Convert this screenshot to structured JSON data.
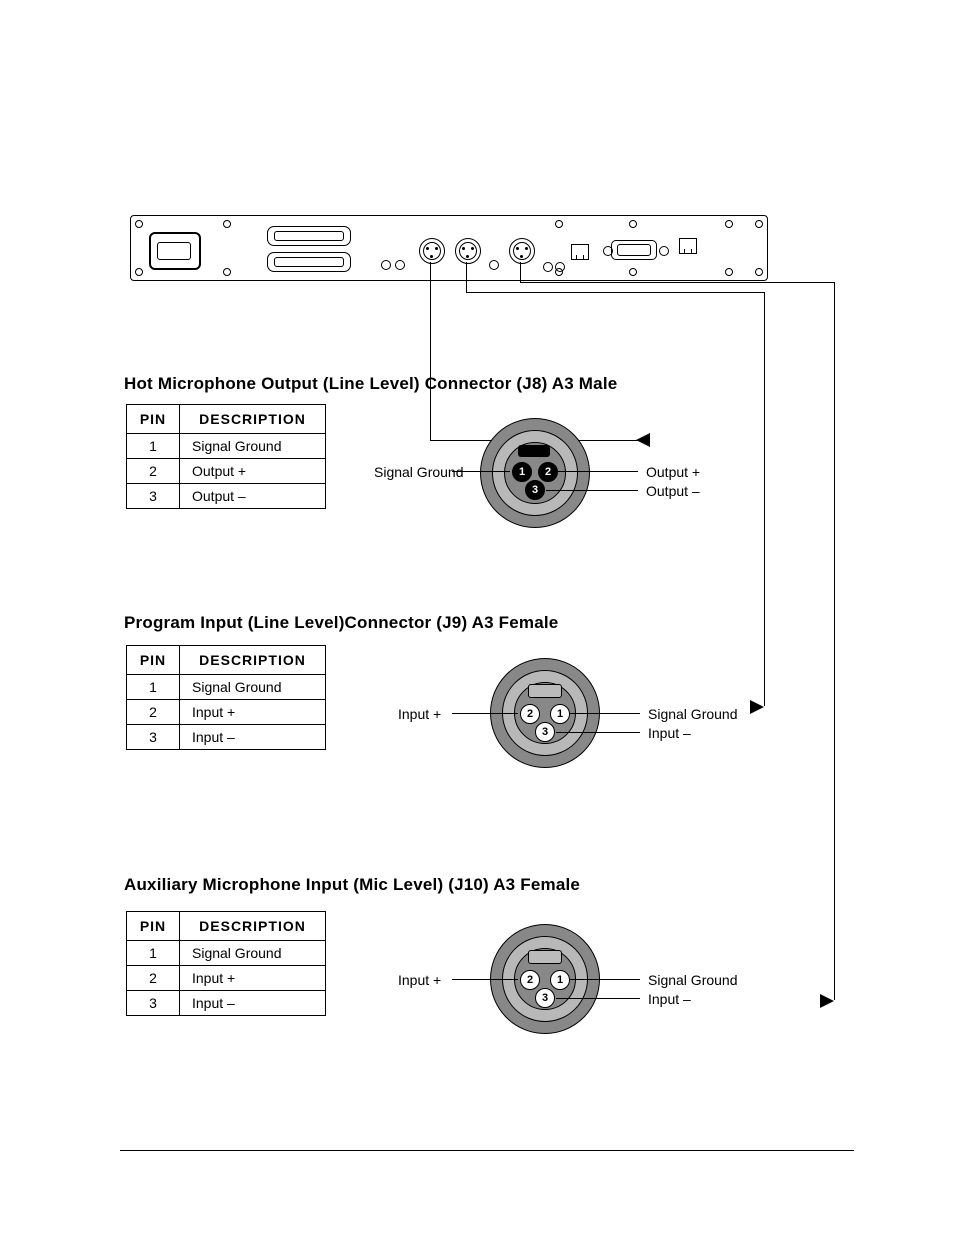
{
  "sections": [
    {
      "title": "Hot Microphone Output (Line Level) Connector (J8) A3 Male",
      "table": {
        "headers": [
          "PIN",
          "DESCRIPTION"
        ],
        "rows": [
          {
            "pin": "1",
            "desc": "Signal Ground"
          },
          {
            "pin": "2",
            "desc": "Output +"
          },
          {
            "pin": "3",
            "desc": "Output –"
          }
        ]
      },
      "diagram": {
        "type": "male",
        "left_label": "Signal Ground",
        "right_top": "Output +",
        "right_bot": "Output –",
        "pins": {
          "left": "1",
          "right": "2",
          "bottom": "3"
        }
      }
    },
    {
      "title": "Program Input (Line Level)Connector (J9) A3 Female",
      "table": {
        "headers": [
          "PIN",
          "DESCRIPTION"
        ],
        "rows": [
          {
            "pin": "1",
            "desc": "Signal Ground"
          },
          {
            "pin": "2",
            "desc": "Input +"
          },
          {
            "pin": "3",
            "desc": "Input –"
          }
        ]
      },
      "diagram": {
        "type": "female",
        "left_label": "Input +",
        "right_top": "Signal Ground",
        "right_bot": "Input –",
        "pins": {
          "left": "2",
          "right": "1",
          "bottom": "3"
        }
      }
    },
    {
      "title": "Auxiliary Microphone Input (Mic Level) (J10) A3 Female",
      "table": {
        "headers": [
          "PIN",
          "DESCRIPTION"
        ],
        "rows": [
          {
            "pin": "1",
            "desc": "Signal Ground"
          },
          {
            "pin": "2",
            "desc": "Input +"
          },
          {
            "pin": "3",
            "desc": "Input –"
          }
        ]
      },
      "diagram": {
        "type": "female",
        "left_label": "Input +",
        "right_top": "Signal Ground",
        "right_bot": "Input –",
        "pins": {
          "left": "2",
          "right": "1",
          "bottom": "3"
        }
      }
    }
  ]
}
